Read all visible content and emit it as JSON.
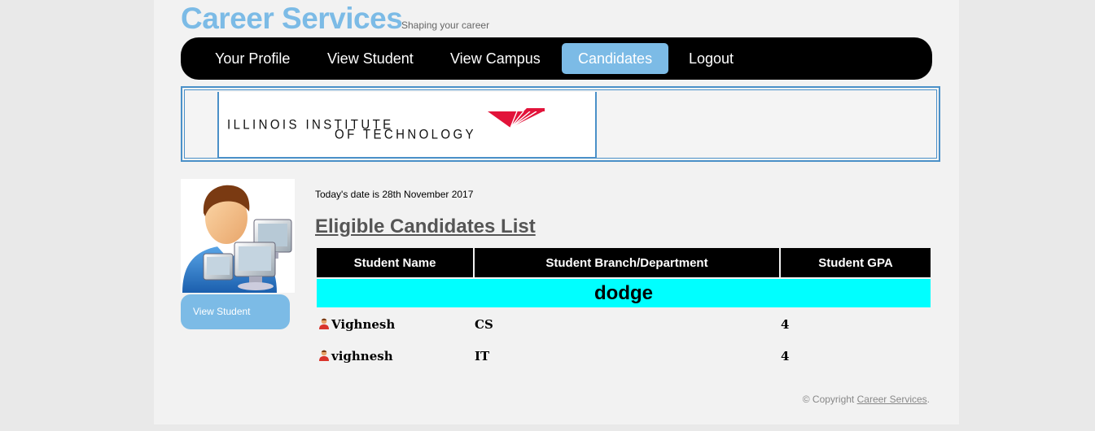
{
  "brand": {
    "title": "Career Services",
    "tagline": "Shaping your career"
  },
  "nav": {
    "items": [
      {
        "label": "Your Profile"
      },
      {
        "label": "View Student"
      },
      {
        "label": "View Campus"
      },
      {
        "label": "Candidates"
      },
      {
        "label": "Logout"
      }
    ],
    "active": "Candidates"
  },
  "banner": {
    "logo_line1": "ILLINOIS INSTITUTE",
    "logo_line2": "OF TECHNOLOGY"
  },
  "sidebar": {
    "avatar_icon": "user-computers-icon",
    "button_label": "View Student"
  },
  "main": {
    "date_text": "Today's date is 28th November 2017",
    "heading": "Eligible Candidates List",
    "table": {
      "headers": [
        "Student Name",
        "Student Branch/Department",
        "Student GPA"
      ],
      "group": "dodge",
      "rows": [
        {
          "name": "Vighnesh",
          "branch": "CS",
          "gpa": "4"
        },
        {
          "name": "vighnesh",
          "branch": "IT",
          "gpa": "4"
        }
      ]
    }
  },
  "footer": {
    "prefix": "© Copyright",
    "link": "Career Services",
    "suffix": "."
  },
  "colors": {
    "accent": "#7cbbe6",
    "nav_bg": "#000000",
    "group_row": "#00ffff",
    "banner_border": "#4a90c8"
  }
}
